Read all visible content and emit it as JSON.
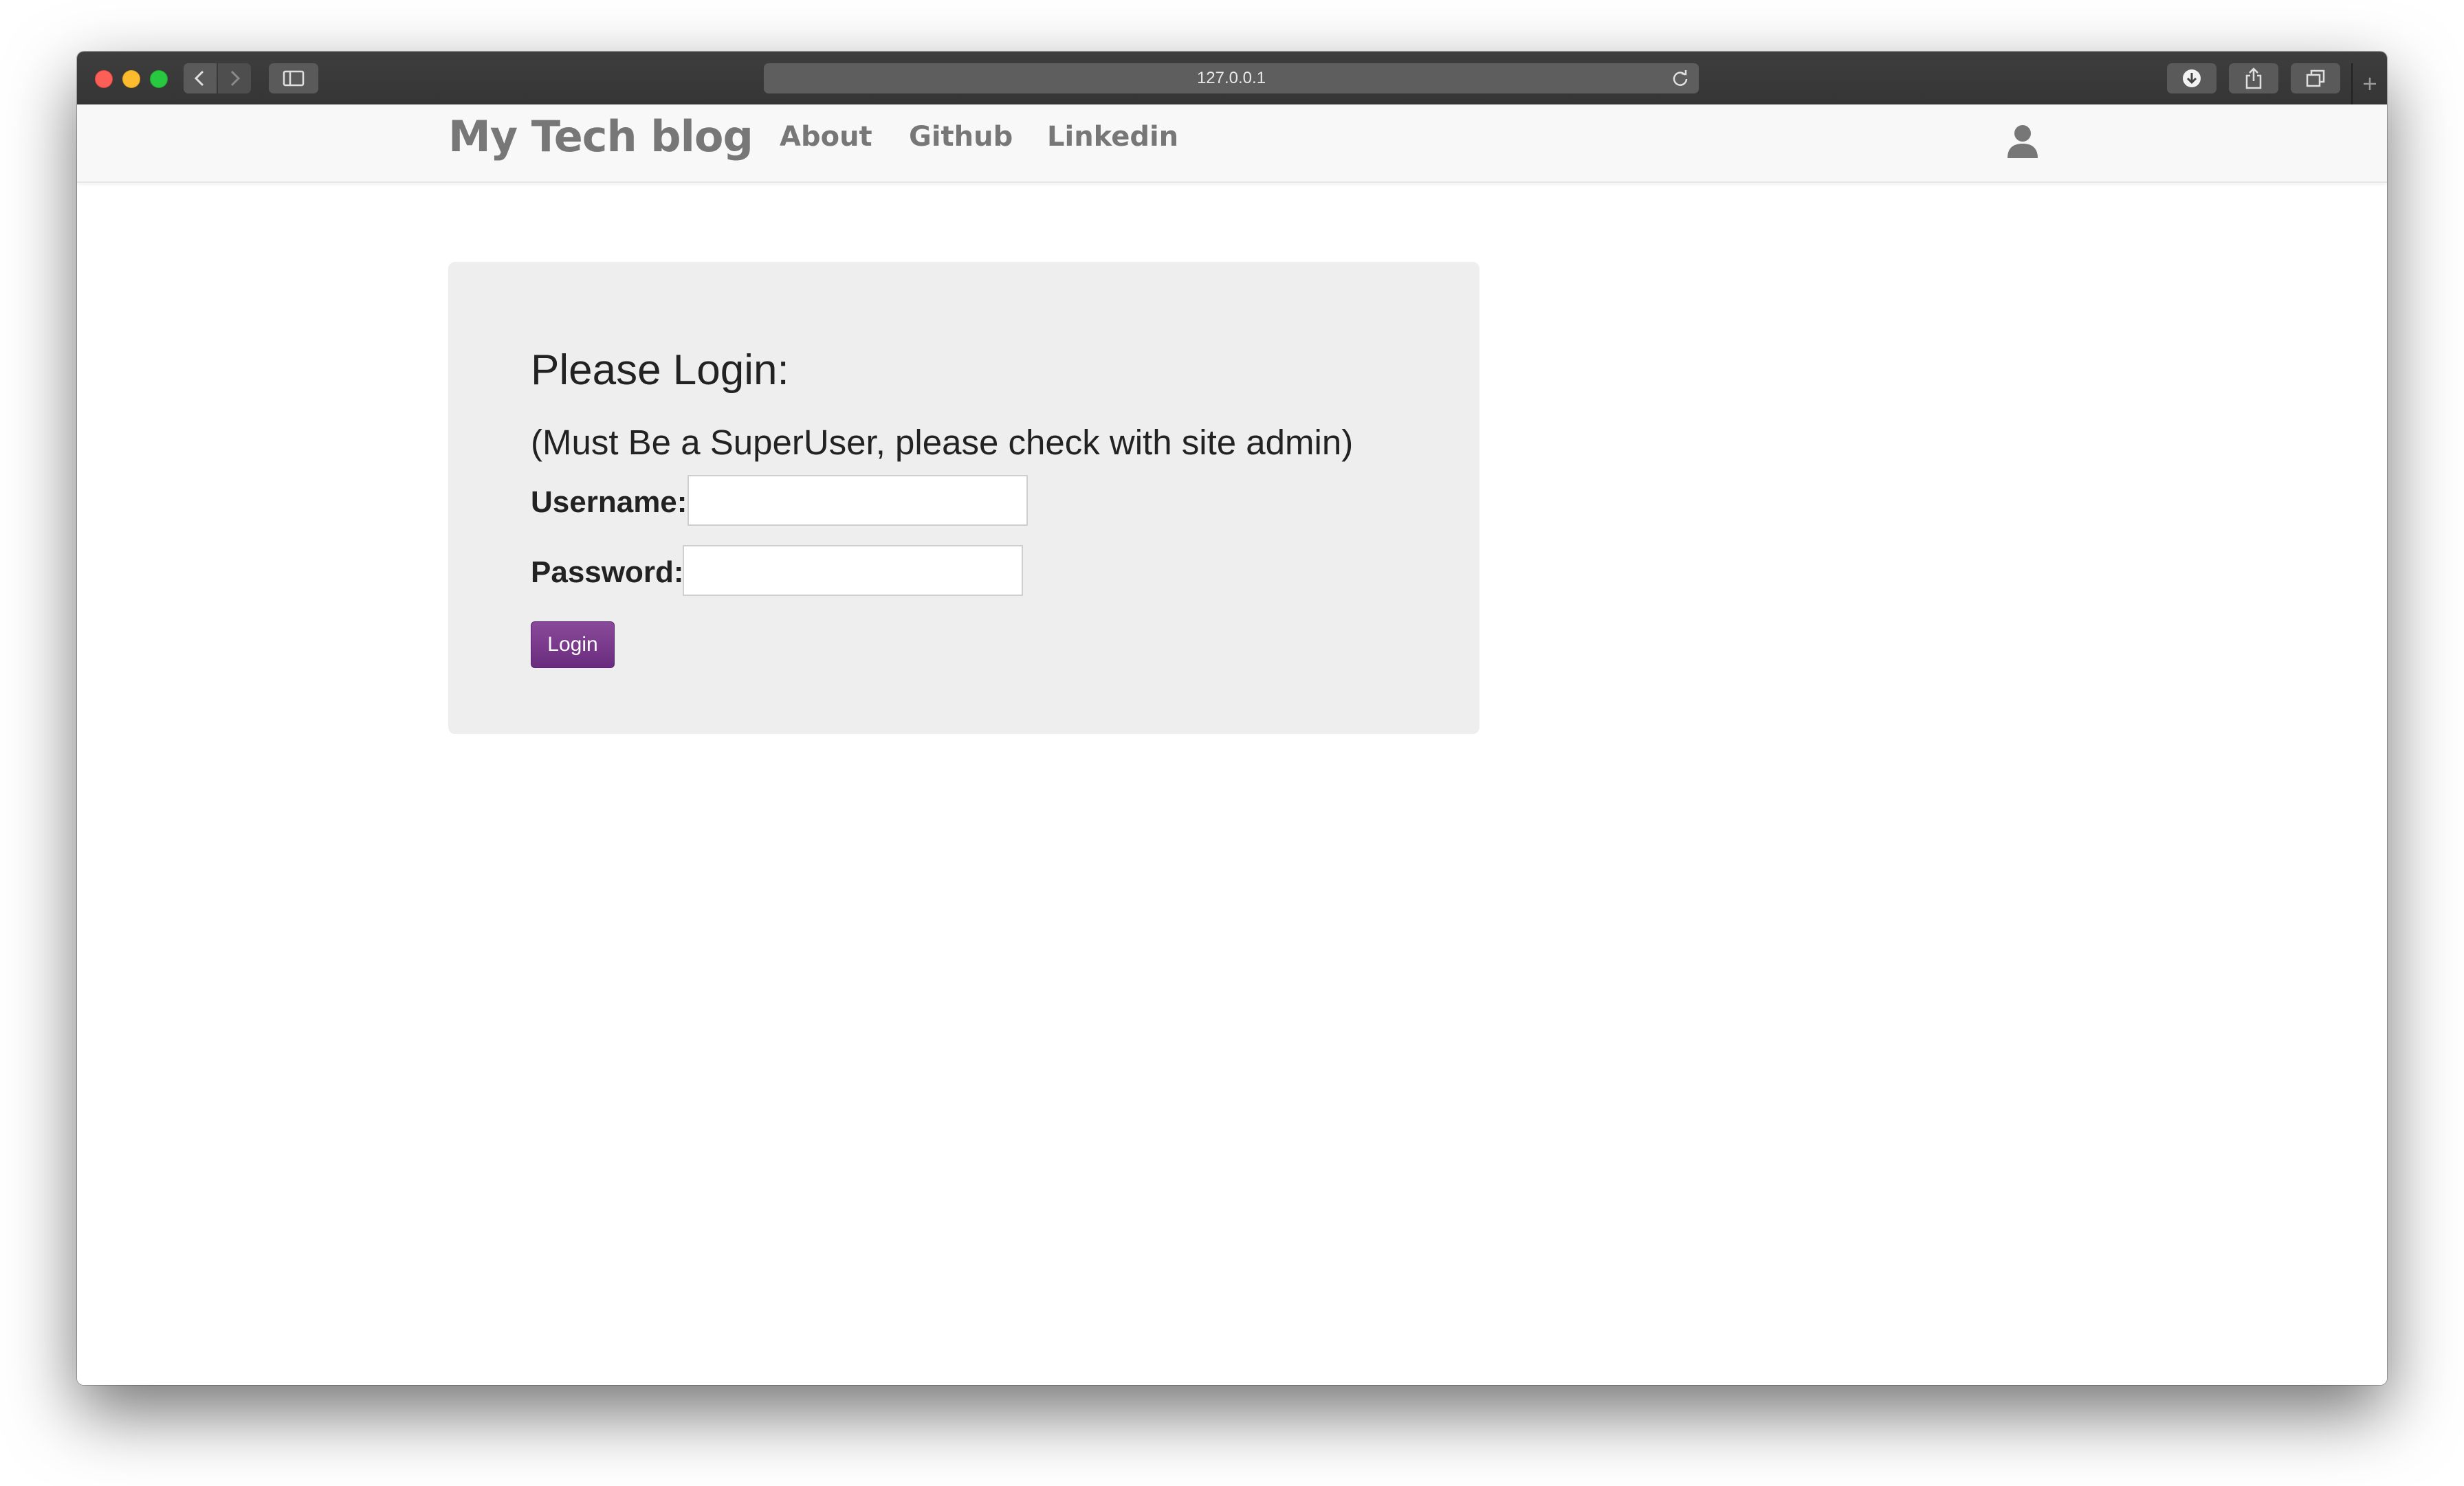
{
  "browser": {
    "url": "127.0.0.1",
    "icons": {
      "back": "chevron-left-icon",
      "forward": "chevron-right-icon",
      "sidebar": "sidebar-icon",
      "reload": "reload-icon",
      "download": "download-icon",
      "share": "share-icon",
      "tabs": "tabs-icon",
      "new_tab": "plus-icon"
    }
  },
  "navbar": {
    "brand": "My Tech blog",
    "links": [
      "About",
      "Github",
      "Linkedin"
    ],
    "user_icon": "user-icon"
  },
  "login": {
    "title": "Please Login:",
    "subtitle": "(Must Be a SuperUser, please check with site admin)",
    "username_label": "Username:",
    "username_value": "",
    "password_label": "Password:",
    "password_value": "",
    "button_label": "Login"
  },
  "colors": {
    "accent": "#7b3b8f",
    "nav_text": "#777777",
    "panel_bg": "#eeeeee"
  }
}
